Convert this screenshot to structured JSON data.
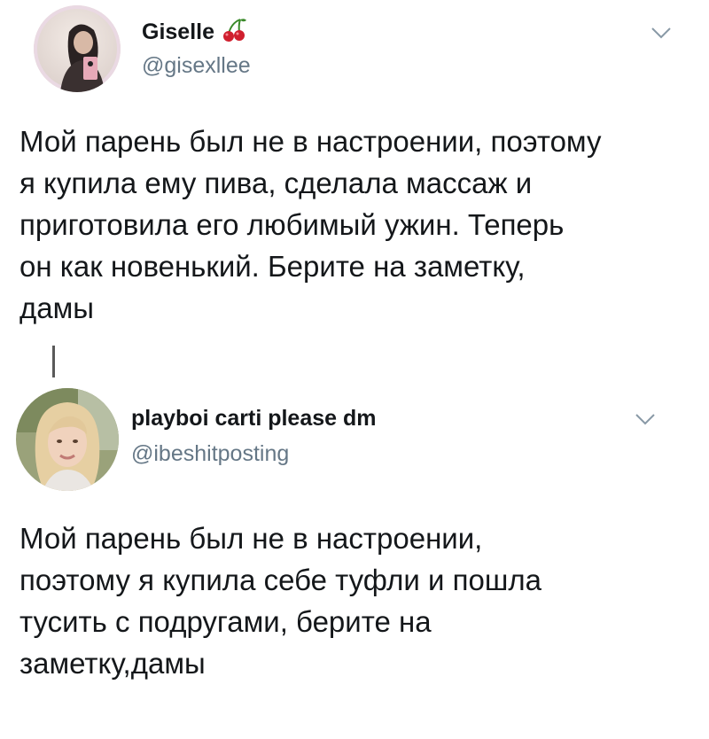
{
  "tweet1": {
    "avatar_icon": "profile-photo-mirror-selfie",
    "name": "Giselle",
    "name_emoji": "cherries-icon",
    "handle": "@gisexllee",
    "menu_icon": "chevron-down-icon",
    "text_lines": [
      "Мой парень был не в настроении, поэтому",
      "я купила ему пива, сделала массаж и",
      "приготовила его любимый ужин. Теперь",
      "он как новенький.  Берите на заметку,",
      "дамы"
    ]
  },
  "tweet2": {
    "avatar_icon": "profile-photo-blonde-girl",
    "name": "playboi carti please dm",
    "handle": "@ibeshitposting",
    "menu_icon": "chevron-down-icon",
    "text_lines": [
      "Мой парень был не в настроении,",
      "поэтому я купила себе туфли и пошла",
      "тусить с подругами, берите на",
      "заметку,дамы"
    ]
  },
  "colors": {
    "text": "#14171a",
    "muted": "#657786",
    "cherry": "#d01f2e",
    "stem": "#3a8a2a"
  }
}
